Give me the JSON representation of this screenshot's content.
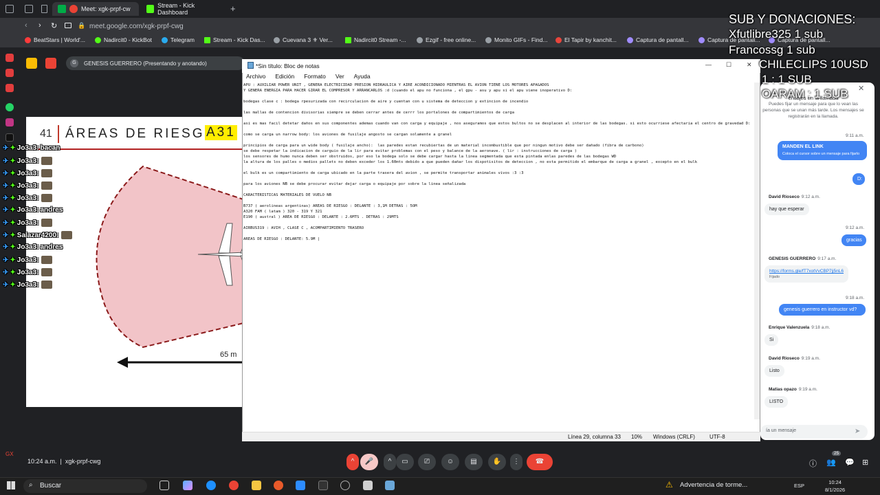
{
  "browser": {
    "tabs": [
      {
        "label": "Meet: xgk-prpf-cw",
        "active": true
      },
      {
        "label": "Stream - Kick Dashboard",
        "active": false
      }
    ],
    "url": "meet.google.com/xgk-prpf-cwg",
    "bookmarks": [
      "BeatStars | World'...",
      "Nadircit0 - KickBot",
      "Telegram",
      "Stream - Kick Das...",
      "Cuevana 3 ⚜ Ver...",
      "Nadircit0 Stream -...",
      "Ezgif - free online...",
      "Monito GIFs - Find...",
      "El Tapir by kanchit...",
      "Captura de pantall...",
      "Captura de pantall...",
      "Captura de pantall..."
    ]
  },
  "meet": {
    "presenting_label": "GENESIS GUERRERO (Presentando y anotando)",
    "presenting_initial": "G",
    "time": "10:24 a.m.",
    "code": "xgk-prpf-cwg",
    "participants_badge": "25"
  },
  "slide": {
    "number": "41",
    "title": "ÁREAS DE RIESGO",
    "highlight": "A31",
    "measure": "65 m"
  },
  "stream_chat": [
    {
      "user": "Jo3a3:",
      "content": "bacan"
    },
    {
      "user": "Jo3a3:",
      "content": ""
    },
    {
      "user": "Jo3a3:",
      "content": ""
    },
    {
      "user": "Jo3a3:",
      "content": ""
    },
    {
      "user": "Jo3a3:",
      "content": ""
    },
    {
      "user": "Jo3a3:",
      "content": "andres"
    },
    {
      "user": "Jo3a3:",
      "content": ""
    },
    {
      "user": "Salazar4200:",
      "content": ""
    },
    {
      "user": "Jo3a3:",
      "content": "andres"
    },
    {
      "user": "Jo3a3:",
      "content": ""
    },
    {
      "user": "Jo3a3:",
      "content": ""
    },
    {
      "user": "Jo3a3:",
      "content": ""
    }
  ],
  "notepad": {
    "title": "*Sin título: Bloc de notas",
    "menu": [
      "Archivo",
      "Edición",
      "Formato",
      "Ver",
      "Ayuda"
    ],
    "content": "APU : AUXILIAR POWER UNIT , GENERA ELECTRICIDAD PRESION HIDRAULICA Y AIRE ACONDICIONADO MIENTRAS EL AVION TIENE LOS MOTORES APAGADOS\nY GENERA ENERGIA PARA HACER GIRAR EL COMPRESOR Y ARRANCARLOS :d (cuando el apu no funciona , el gpu - asu y apu si el apu viene inoperativo D:\n\nbodegas clase c : bodega rpesurizada con recirculacion de aire y cuentan con u sistema de deteccion y extincion de incendio\n\nlas mallas de contencion divisorias siempre se deben cerrar antes de cerrr los portalones de compartimientos de carga\n\nasi es mas facil detetar daños en sus componentes ademas cuando van con carga y equipaje , nos aseguramos que estos bultos no se desplacen al interior de las bodegas. si esto ocurriese afectaria el centro de gravedad D:\n\ncomo se carga un narrow body: los aviones de fusilaje angosto se cargan solamente a granel\n\nprincipios de carga para un wide body ( fusilaje ancho):  las paredes estan recubiertas de un material incombustible que por ningun motivo debe ser dañado (fibra de carbono)\nse debe respetar la indicacion de carguio de la lir para evitar problemas con el peso y balance de la aeronave. ( lir : instrucciones de carga )\nlos sensores de humo nunca deben ser obstruidos, por eso la bodega solo se debe cargar hasta la linea segmentada que esta pintada enlas paredes de las bodegas WD\nla altura de los palles o medios pallets no deben exceder los 1.60mts debido a que pueden dañar los dispotisitos de deteccion , no esta permitido el embarque de carga a granel , excepto en el bulk\n\nel bulk es un compartimiento de carga ubicado en la parte trasera del avion , se permite transportar animales vivos :3 :3\n\npara los aviones NB se debe procurar evitar dejar carga o equipaje por sobre la linea señalizada\n\nCARACTERISTICAS MATERIALES DE VUELO NB\n\nB737 ( aerolineas argentinas) AREAS DE RIESGO : DELANTE : 3,1M DETRAS : 5OM\nA320 FAM ( latam ) 320 - 319 Y 321\nE190 ( austral ) AREA DE RIESGO : DELANTE : 2.6MTS . DETRAS : 29MTS\n\nAIRBUS319 : AVIH , CLASE C , ACOMPARTIMIENTO TRASERO\n\nAREAS DE RIESGO : DELANTE: 5.9M |",
    "status": {
      "position": "Línea 29, columna 33",
      "zoom": "10%",
      "eol": "Windows (CRLF)",
      "encoding": "UTF-8"
    }
  },
  "side_chat": {
    "info": "Puedes fijar un mensaje para que lo vean las personas que se unan más tarde. Los mensajes se registrarán en la llamada.",
    "info_head": "ensajes en la llamada",
    "messages": [
      {
        "time": "9:11 a.m."
      },
      {
        "bubble": "MANDEN EL LINK",
        "sub": "Coloca el cursor sobre un mensaje para fijarlo"
      },
      {
        "bubble": "D:"
      },
      {
        "name": "David Rioseco",
        "time": "9:12 a.m.",
        "text": "hay que esperar"
      },
      {
        "time": "9:12 a.m."
      },
      {
        "bubble": "gracias"
      },
      {
        "name": "GENESIS GUERRERO",
        "time": "9:17 a.m.",
        "text": "https://forms.gle/fT7xotVvCBP7jj5nL6",
        "pinned": "Fijado"
      },
      {
        "time": "9:18 a.m."
      },
      {
        "bubble": "genesis guerrero en instructor vd?"
      },
      {
        "name": "Enrique Valenzuela",
        "time": "9:18 a.m.",
        "text": "Si"
      },
      {
        "name": "David Rioseco",
        "time": "9:19 a.m.",
        "text": "Listo"
      },
      {
        "name": "Matias opazo",
        "time": "9:19 a.m.",
        "text": "LISTO"
      }
    ],
    "send_placeholder": "ía un mensaje"
  },
  "overlay": {
    "lines": [
      "SUB Y DONACIONES:",
      "Xfutlibre325 1 sub",
      "Francossg 1 sub",
      "CHILECLIPS 10USD",
      "1 : 1 SUB",
      "OARAM : 1 SUB"
    ]
  },
  "taskbar": {
    "search": "Buscar",
    "weather": "Advertencia de torme...",
    "lang": "ESP",
    "time": "10:24",
    "date": "8/1/2026"
  },
  "colors": {
    "meet_red": "#ea4335",
    "kick_green": "#53fc18",
    "meet_blue": "#4285f4",
    "highlight": "#ffee00"
  }
}
